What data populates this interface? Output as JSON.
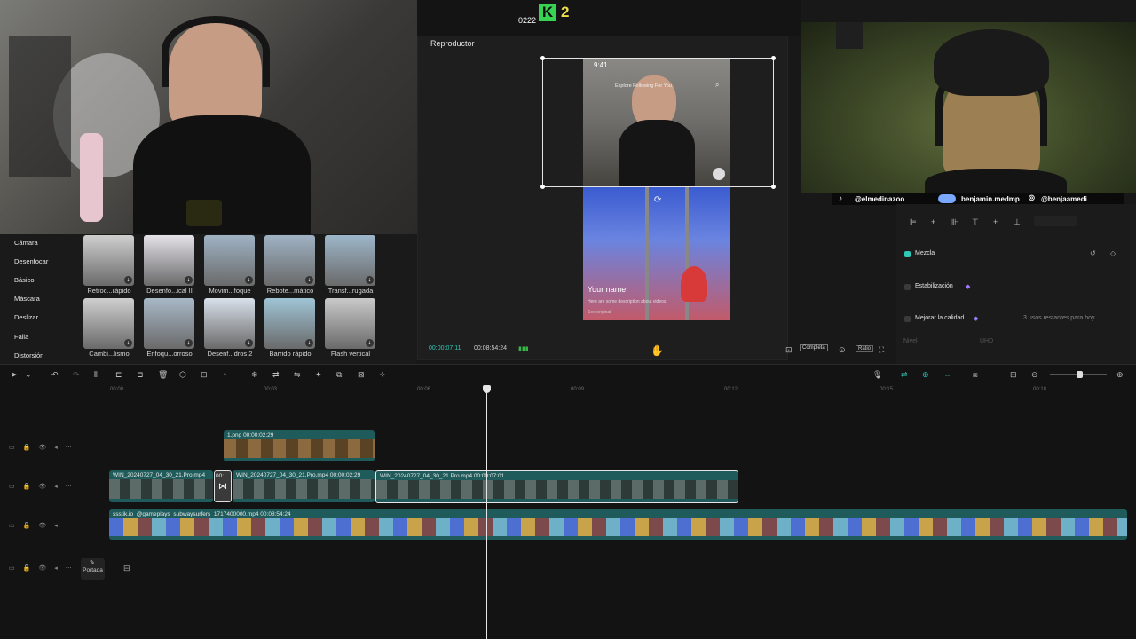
{
  "overlay": {
    "record_count": "0222",
    "logo_letter": "K",
    "logo_number": "2"
  },
  "player": {
    "title": "Reproductor",
    "phone_time": "9:41",
    "phone_tabs": "Explore  Following  For You",
    "caption_name": "Your name",
    "caption_desc": "Here are some description about videos",
    "caption_original": "See original",
    "current_time": "00:00:07:11",
    "total_time": "00:08:54:24",
    "complete_label": "Completa",
    "ratio_label": "Ratio"
  },
  "socials": {
    "tiktok": "@elmedinazoo",
    "kick": "benjamin.medmp",
    "instagram": "@benjaamedi"
  },
  "right_panel": {
    "blend_label": "Mezcla",
    "stabilize_label": "Estabilización",
    "improve_label": "Mejorar la calidad",
    "uses_left": "3 usos restantes para hoy",
    "level_label": "Nivel",
    "level_value": "UHD"
  },
  "effects": {
    "categories": [
      "Cámara",
      "Desenfocar",
      "Básico",
      "Máscara",
      "Deslizar",
      "Falla",
      "Distorsión"
    ],
    "row1": [
      "Retroc...rápido",
      "Desenfo...ical II",
      "Movim...foque",
      "Rebote...mático",
      "Transf...rugada"
    ],
    "row2": [
      "Cambi...lismo",
      "Enfoqu...orroso",
      "Desenf...dros 2",
      "Barrido rápido",
      "Flash vertical"
    ]
  },
  "timeline": {
    "ticks": [
      "00:00",
      "00:03",
      "00:06",
      "00:09",
      "00:12",
      "00:15",
      "00:18"
    ],
    "overlay_clip": "1.png   00:00:02:29",
    "clip_a": "WIN_20240727_04_30_21.Pro.mp4",
    "clip_a_short": "00:",
    "clip_b": "WIN_20240727_04_30_21.Pro.mp4   00:00:02:29",
    "clip_c": "WIN_20240727_04_30_21.Pro.mp4   00:00:07:01",
    "bg_clip": "ssstik.io_@gameplays_subwaysurfers_1717400000.mp4   00:08:54:24",
    "cover_label": "Portada"
  }
}
